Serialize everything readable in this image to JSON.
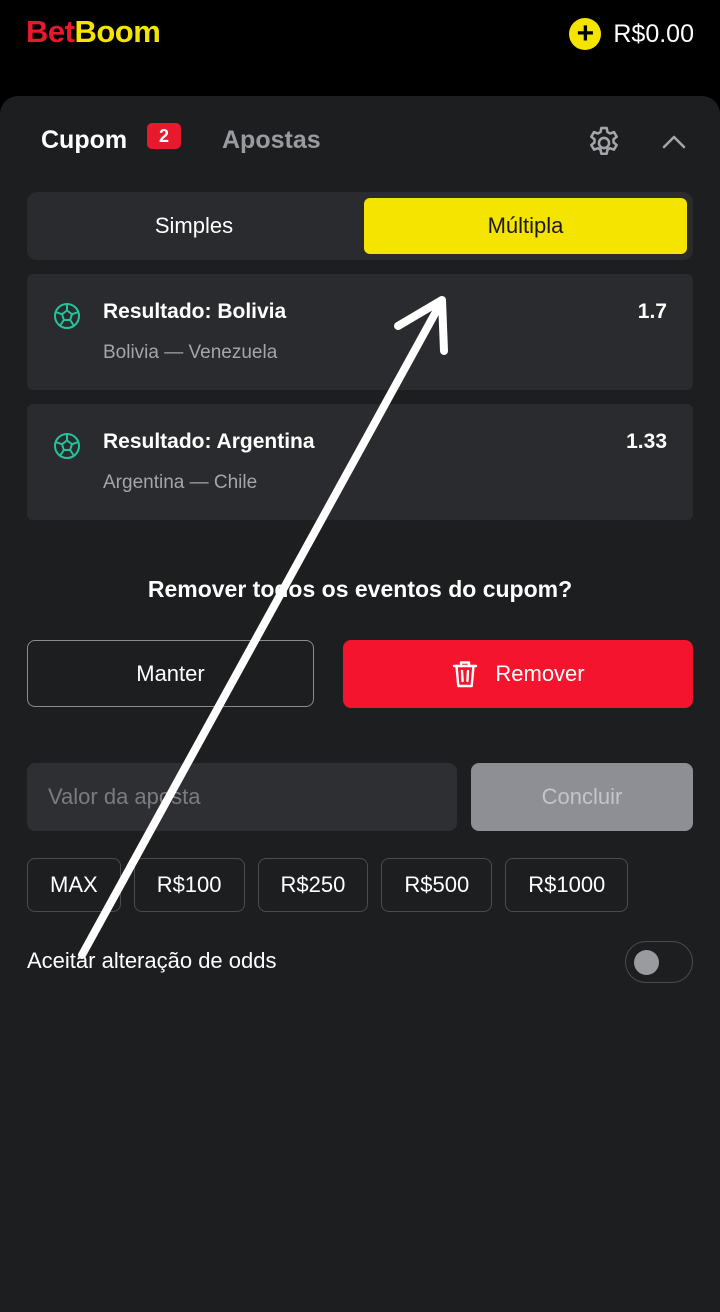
{
  "header": {
    "logo_part1": "Bet",
    "logo_part2": "Boom",
    "balance": "R$0.00",
    "brand_red": "#e8192c",
    "brand_yellow": "#f5e400"
  },
  "tabs": {
    "cupom_label": "Cupom",
    "cupom_count": "2",
    "apostas_label": "Apostas"
  },
  "bet_type": {
    "simples_label": "Simples",
    "multipla_label": "Múltipla",
    "selected": "Múltipla"
  },
  "events": [
    {
      "title": "Resultado: Bolivia",
      "match": "Bolivia — Venezuela",
      "odd": "1.7"
    },
    {
      "title": "Resultado: Argentina",
      "match": "Argentina — Chile",
      "odd": "1.33"
    }
  ],
  "confirm": {
    "question": "Remover todos os eventos do cupom?",
    "keep_label": "Manter",
    "remove_label": "Remover"
  },
  "stake": {
    "placeholder": "Valor da aposta",
    "conclude_label": "Concluir"
  },
  "quick_amounts": [
    "MAX",
    "R$100",
    "R$250",
    "R$500",
    "R$1000"
  ],
  "odds_change": {
    "label": "Aceitar alteração de odds",
    "enabled": false
  }
}
